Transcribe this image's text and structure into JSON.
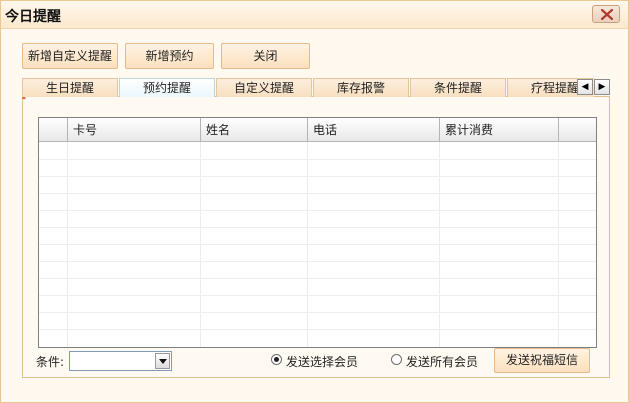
{
  "window": {
    "title": "今日提醒"
  },
  "toolbar": {
    "add_custom_label": "新增自定义提醒",
    "add_appointment_label": "新增预约",
    "close_label": "关闭"
  },
  "tabs": [
    {
      "label": "生日提醒",
      "active": false
    },
    {
      "label": "预约提醒",
      "active": true
    },
    {
      "label": "自定义提醒",
      "active": false
    },
    {
      "label": "库存报警",
      "active": false
    },
    {
      "label": "条件提醒",
      "active": false
    },
    {
      "label": "疗程提醒",
      "active": false
    }
  ],
  "table": {
    "columns": [
      "卡号",
      "姓名",
      "电话",
      "累计消费"
    ]
  },
  "footer": {
    "condition_label": "条件:",
    "condition_value": "",
    "radio_selected_label": "发送选择会员",
    "radio_all_label": "发送所有会员",
    "selected_option": "发送选择会员",
    "send_button_label": "发送祝福短信"
  },
  "icons": {
    "close": "close-icon",
    "tab_left": "chevron-left-icon",
    "tab_right": "chevron-right-icon",
    "dropdown": "chevron-down-icon"
  },
  "colors": {
    "close_x": "#b03a2e",
    "button_border": "#e7b98a",
    "grid_border": "#808080"
  }
}
